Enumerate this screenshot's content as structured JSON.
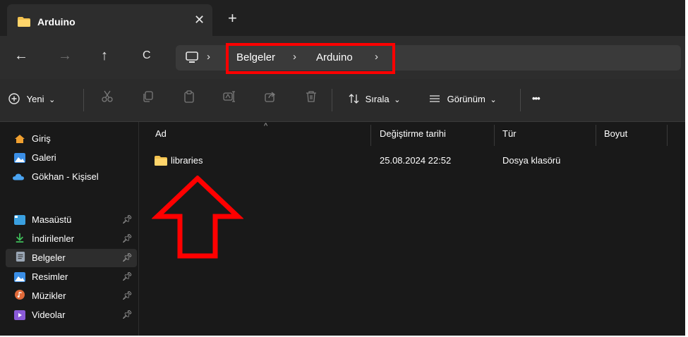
{
  "tab": {
    "title": "Arduino",
    "close": "✕",
    "new": "+"
  },
  "nav": {
    "back": "←",
    "forward": "→",
    "up": "↑",
    "refresh": "C"
  },
  "breadcrumb": {
    "sep": "›",
    "items": [
      "Belgeler",
      "Arduino"
    ]
  },
  "toolbar": {
    "new_label": "Yeni",
    "sort_label": "Sırala",
    "view_label": "Görünüm",
    "more": "•••",
    "chevron": "⌄"
  },
  "sidebar": {
    "items": [
      {
        "label": "Giriş",
        "icon": "home-icon",
        "color": "#f0a030"
      },
      {
        "label": "Galeri",
        "icon": "gallery-icon",
        "color": "#3a8ee6"
      },
      {
        "label": "Gökhan - Kişisel",
        "icon": "onedrive-icon",
        "color": "#4aa3f0"
      },
      {
        "label": "Masaüstü",
        "icon": "desktop-icon",
        "color": "#3aa0e0",
        "pinned": true
      },
      {
        "label": "İndirilenler",
        "icon": "download-icon",
        "color": "#3fbf5a",
        "pinned": true
      },
      {
        "label": "Belgeler",
        "icon": "documents-icon",
        "color": "#9aa6b4",
        "pinned": true,
        "active": true
      },
      {
        "label": "Resimler",
        "icon": "pictures-icon",
        "color": "#3a8ee6",
        "pinned": true
      },
      {
        "label": "Müzikler",
        "icon": "music-icon",
        "color": "#e06a3a",
        "pinned": true
      },
      {
        "label": "Videolar",
        "icon": "videos-icon",
        "color": "#8a5ad8",
        "pinned": true
      }
    ]
  },
  "columns": {
    "name": "Ad",
    "date": "Değiştirme tarihi",
    "type": "Tür",
    "size": "Boyut",
    "sort_caret": "^"
  },
  "files": [
    {
      "name": "libraries",
      "date": "25.08.2024 22:52",
      "type": "Dosya klasörü",
      "size": ""
    }
  ],
  "colors": {
    "annotation": "#ff0000",
    "folder": "#f2c14e"
  }
}
